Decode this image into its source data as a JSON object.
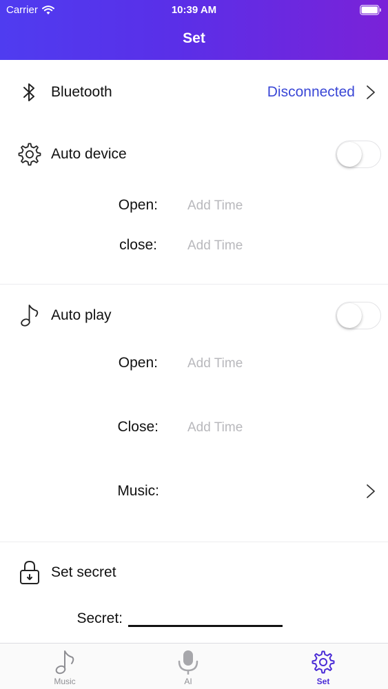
{
  "status_bar": {
    "carrier": "Carrier",
    "time": "10:39 AM"
  },
  "nav": {
    "title": "Set"
  },
  "bluetooth": {
    "label": "Bluetooth",
    "value": "Disconnected",
    "value_color": "#3a47d6"
  },
  "auto_device": {
    "label": "Auto device",
    "enabled": false,
    "open_label": "Open:",
    "open_value": "Add Time",
    "close_label": "close:",
    "close_value": "Add Time"
  },
  "auto_play": {
    "label": "Auto play",
    "enabled": false,
    "open_label": "Open:",
    "open_value": "Add Time",
    "close_label": "Close:",
    "close_value": "Add Time",
    "music_label": "Music:"
  },
  "secret": {
    "label": "Set secret",
    "field_label": "Secret:",
    "field_value": ""
  },
  "tabbar": {
    "accent_color": "#4a2bd6",
    "items": [
      {
        "label": "Music",
        "icon": "music-note-icon"
      },
      {
        "label": "AI",
        "icon": "microphone-icon"
      },
      {
        "label": "Set",
        "icon": "gear-icon",
        "active": true
      }
    ]
  }
}
